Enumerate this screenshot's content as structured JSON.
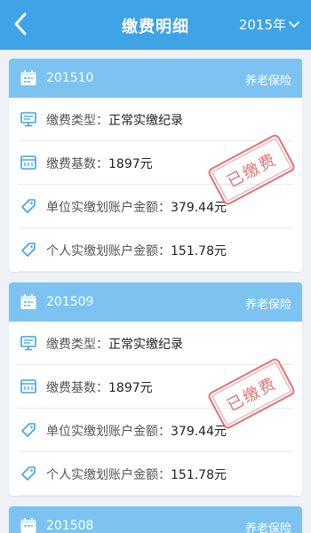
{
  "header": {
    "title": "缴费明细",
    "year": "2015年"
  },
  "records": [
    {
      "period": "201510",
      "insurance_type": "养老保险",
      "fee_type_label": "缴费类型：",
      "fee_type_value": "正常实缴纪录",
      "base_label": "缴费基数：",
      "base_value": "1897元",
      "unit_label": "单位实缴划账户金额：",
      "unit_value": "379.44元",
      "personal_label": "个人实缴划账户金额：",
      "personal_value": "151.78元",
      "stamp": "已缴费"
    },
    {
      "period": "201509",
      "insurance_type": "养老保险",
      "fee_type_label": "缴费类型：",
      "fee_type_value": "正常实缴纪录",
      "base_label": "缴费基数：",
      "base_value": "1897元",
      "unit_label": "单位实缴划账户金额：",
      "unit_value": "379.44元",
      "personal_label": "个人实缴划账户金额：",
      "personal_value": "151.78元",
      "stamp": "已缴费"
    },
    {
      "period": "201508",
      "insurance_type": "养老保险"
    }
  ],
  "colors": {
    "header_bg": "#3fa3e8",
    "card_head_bg": "#7cc3f1",
    "icon": "#3fa3e8",
    "stamp": "#e05a5a"
  }
}
